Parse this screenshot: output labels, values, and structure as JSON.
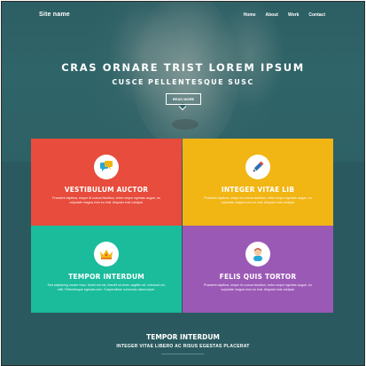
{
  "header": {
    "site_name": "Site name",
    "nav": [
      "Home",
      "About",
      "Work",
      "Contact"
    ]
  },
  "hero": {
    "title": "CRAS ORNARE TRIST LOREM IPSUM",
    "subtitle": "CUSCE PELLENTESQUE SUSC",
    "button_label": "READ MORE"
  },
  "tiles": [
    {
      "title": "VESTIBULUM AUCTOR",
      "text": "Praesent dapibus, neque id cursus faucibus, tortor neque egestas augue, eu vulputate magna eros eu erat. Aliquam erat volutpat.",
      "color": "#e74c3c",
      "icon": "speech-bubbles-icon"
    },
    {
      "title": "INTEGER VITAE LIB",
      "text": "Praesent dapibus, neque id cursus faucibus, tortor neque egestas augue, eu vulputate magna eros eu erat. Aliquam erat volutpat.",
      "color": "#f1b514",
      "icon": "pencil-icon"
    },
    {
      "title": "TEMPOR INTERDUM",
      "text": "Sed adipiscing ornare risus. Morbi est est, blandit sit amet, sagittis vel, euismod vel, velit. Pellentesque egestas sem. Suspendisse commodo ullamcorper.",
      "color": "#1abc9c",
      "icon": "crown-icon"
    },
    {
      "title": "FELIS QUIS TORTOR",
      "text": "Praesent dapibus, neque id cursus faucibus, tortor neque egestas augue, eu vulputate magna eros eu erat. Aliquam erat volutpat.",
      "color": "#9b59b6",
      "icon": "user-icon"
    }
  ],
  "footer": {
    "title": "TEMPOR INTERDUM",
    "subtitle": "INTEGER VITAE LIBERO AC RISUS EGESTAS PLACERAT"
  }
}
